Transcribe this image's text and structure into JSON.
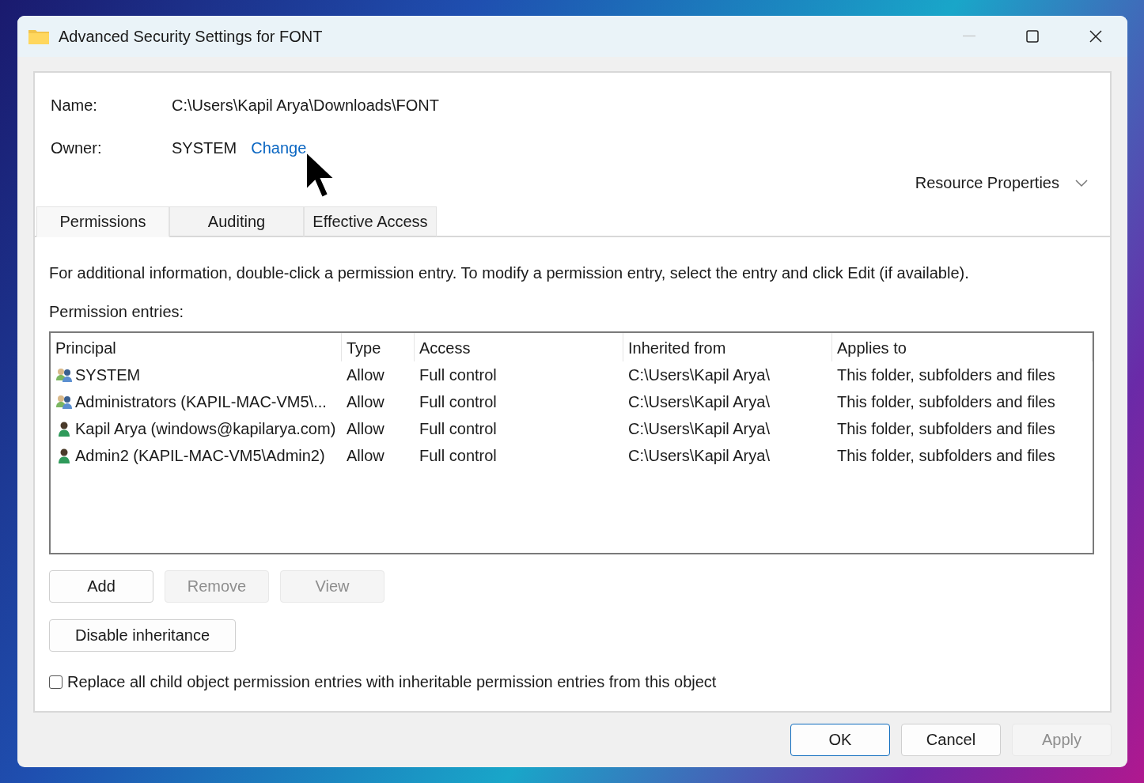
{
  "window": {
    "title": "Advanced Security Settings for FONT"
  },
  "name": {
    "label": "Name:",
    "value": "C:\\Users\\Kapil Arya\\Downloads\\FONT"
  },
  "owner": {
    "label": "Owner:",
    "value": "SYSTEM",
    "link": "Change"
  },
  "resource_properties": {
    "label": "Resource Properties",
    "expanded": false
  },
  "tabs": [
    {
      "label": "Permissions",
      "selected": true
    },
    {
      "label": "Auditing",
      "selected": false
    },
    {
      "label": "Effective Access",
      "selected": false
    }
  ],
  "info_text": "For additional information, double-click a permission entry. To modify a permission entry, select the entry and click Edit (if available).",
  "entries_label": "Permission entries:",
  "table": {
    "columns": [
      "Principal",
      "Type",
      "Access",
      "Inherited from",
      "Applies to"
    ],
    "rows": [
      {
        "kind": "group",
        "principal": "SYSTEM",
        "type": "Allow",
        "access": "Full control",
        "inherited_from": "C:\\Users\\Kapil Arya\\",
        "applies_to": "This folder, subfolders and files"
      },
      {
        "kind": "group",
        "principal": "Administrators (KAPIL-MAC-VM5\\...",
        "type": "Allow",
        "access": "Full control",
        "inherited_from": "C:\\Users\\Kapil Arya\\",
        "applies_to": "This folder, subfolders and files"
      },
      {
        "kind": "user",
        "principal": "Kapil Arya (windows@kapilarya.com)",
        "type": "Allow",
        "access": "Full control",
        "inherited_from": "C:\\Users\\Kapil Arya\\",
        "applies_to": "This folder, subfolders and files"
      },
      {
        "kind": "user",
        "principal": "Admin2 (KAPIL-MAC-VM5\\Admin2)",
        "type": "Allow",
        "access": "Full control",
        "inherited_from": "C:\\Users\\Kapil Arya\\",
        "applies_to": "This folder, subfolders and files"
      }
    ]
  },
  "entry_buttons": [
    {
      "label": "Add",
      "disabled": false
    },
    {
      "label": "Remove",
      "disabled": true
    },
    {
      "label": "View",
      "disabled": true
    }
  ],
  "inheritance_button": {
    "label": "Disable inheritance",
    "disabled": false
  },
  "replace_checkbox": {
    "label": "Replace all child object permission entries with inheritable permission entries from this object",
    "checked": false
  },
  "dialog_buttons": [
    {
      "label": "OK",
      "disabled": false,
      "default": true
    },
    {
      "label": "Cancel",
      "disabled": false,
      "default": false
    },
    {
      "label": "Apply",
      "disabled": true,
      "default": false
    }
  ]
}
